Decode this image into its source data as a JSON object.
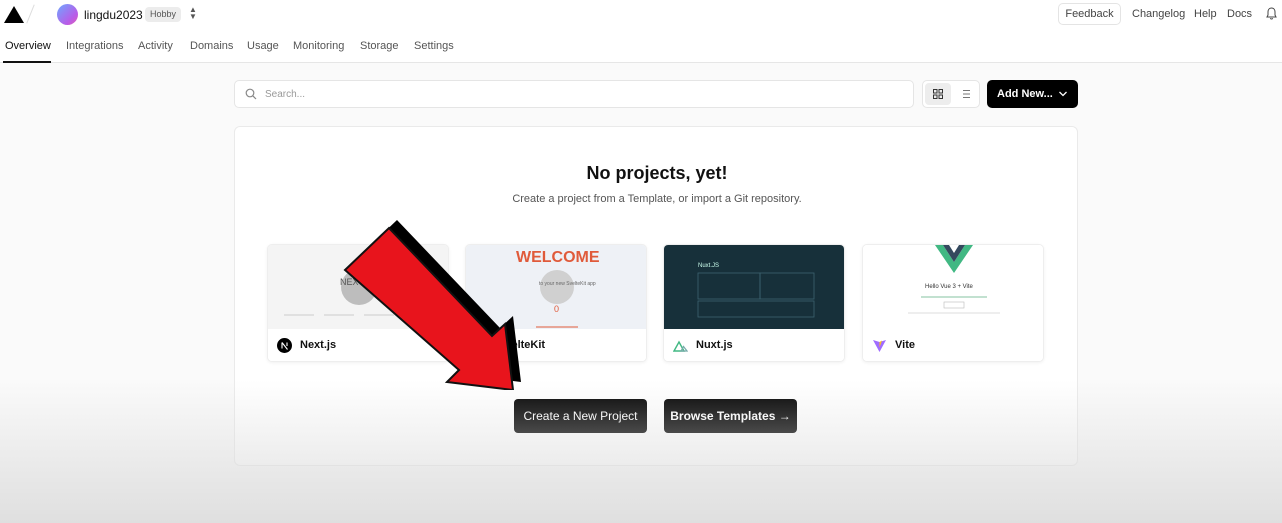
{
  "header": {
    "username": "lingdu2023",
    "plan": "Hobby",
    "feedback": "Feedback",
    "links": [
      "Changelog",
      "Help",
      "Docs"
    ]
  },
  "tabs": [
    "Overview",
    "Integrations",
    "Activity",
    "Domains",
    "Usage",
    "Monitoring",
    "Storage",
    "Settings"
  ],
  "toolbar": {
    "search_placeholder": "Search...",
    "add_new": "Add New..."
  },
  "empty": {
    "title": "No projects, yet!",
    "subtitle": "Create a project from a Template, or import a Git repository."
  },
  "templates": [
    {
      "name": "Next.js",
      "thumb_text": "NEXT"
    },
    {
      "name": "SvelteKit",
      "thumb_text": "WELCOME",
      "thumb_sub": "to your new SvelteKit app",
      "thumb_counter": "0"
    },
    {
      "name": "Nuxt.js",
      "thumb_text": "Nuxt.JS"
    },
    {
      "name": "Vite",
      "thumb_text": "Hello Vue 3 + Vite"
    }
  ],
  "actions": {
    "create": "Create a New Project",
    "browse": "Browse Templates →"
  },
  "colors": {
    "primary": "#000000",
    "arrow": "#e8141c",
    "vue_green": "#41b883",
    "nuxt_bg": "#17303a"
  }
}
